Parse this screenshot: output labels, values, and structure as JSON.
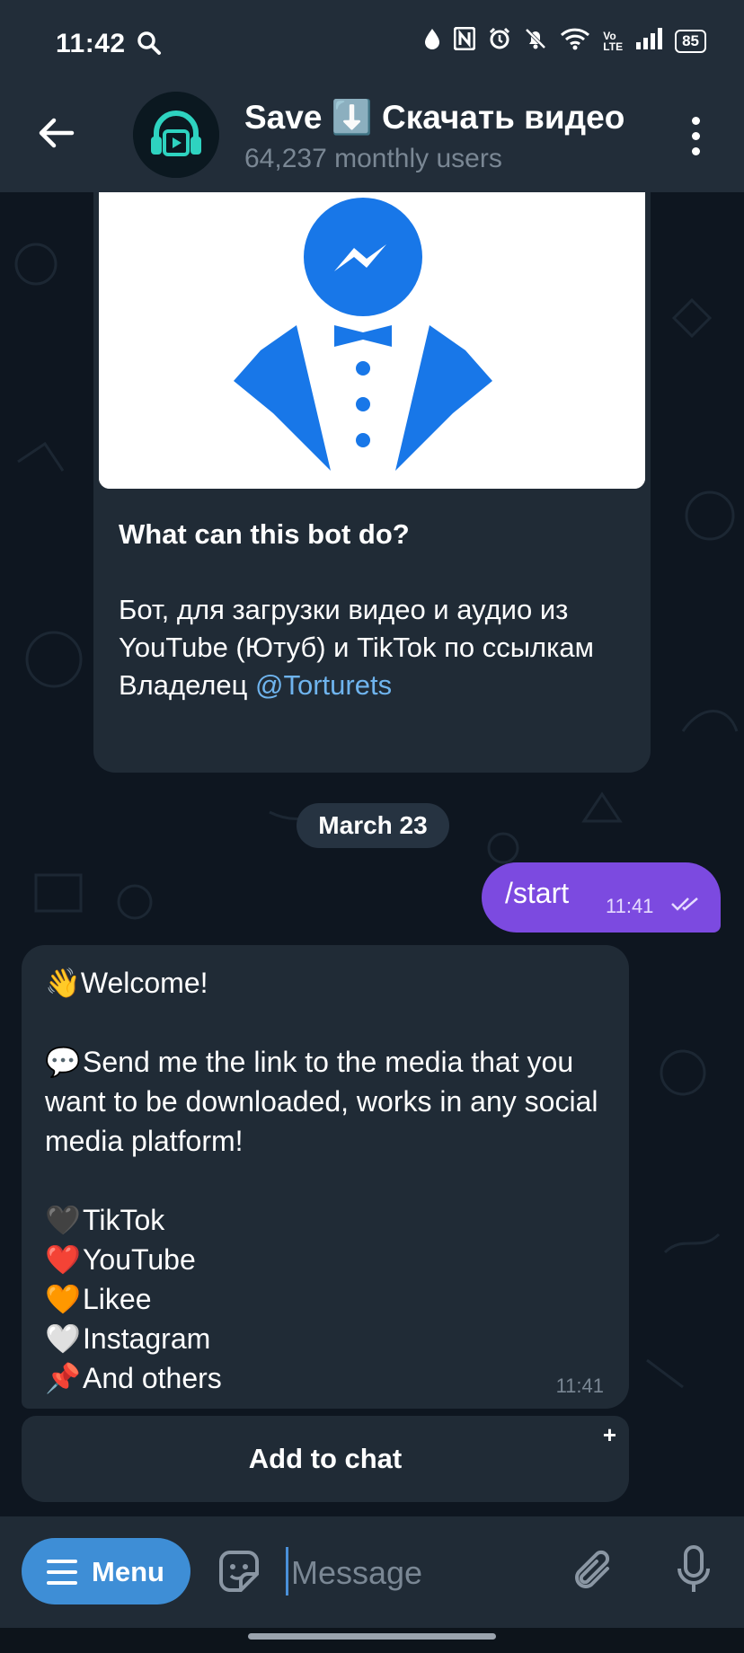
{
  "status_bar": {
    "time": "11:42",
    "battery": "85",
    "icons": [
      "search-icon",
      "drop-icon",
      "nfc-icon",
      "alarm-icon",
      "mute-icon",
      "wifi-icon",
      "volte-icon",
      "signal-icon",
      "battery-icon"
    ]
  },
  "header": {
    "title": "Save ⬇️ Скачать видео",
    "subtitle": "64,237 monthly users"
  },
  "intro": {
    "heading": "What can this bot do?",
    "line1": "Бот, для загрузки видео и аудио из YouTube (Ютуб) и TikTok по ссылкам",
    "owner_label": "Владелец",
    "owner_link": "@Torturets"
  },
  "date_chip": "March 23",
  "outgoing": {
    "text": "/start",
    "time": "11:41"
  },
  "bot_message": {
    "welcome_emoji": "👋",
    "welcome": "Welcome!",
    "send_emoji": "💬",
    "send": "Send me the link to the media that you want to be downloaded, works in any social media platform!",
    "platforms": [
      {
        "emoji": "🖤",
        "label": "TikTok"
      },
      {
        "emoji": "❤️",
        "label": "YouTube"
      },
      {
        "emoji": "🧡",
        "label": "Likee"
      },
      {
        "emoji": "🤍",
        "label": "Instagram"
      },
      {
        "emoji": "📌",
        "label": "And others"
      }
    ],
    "time": "11:41"
  },
  "add_button": {
    "label": "Add to chat",
    "plus": "+"
  },
  "input_bar": {
    "menu_label": "Menu",
    "placeholder": "Message"
  },
  "colors": {
    "header_bg": "#222d39",
    "chat_bg": "#0e1620",
    "bubble_in": "#202b36",
    "bubble_out": "#7c4ae0",
    "menu_button": "#3e8ed6",
    "link": "#6fb4ee"
  }
}
